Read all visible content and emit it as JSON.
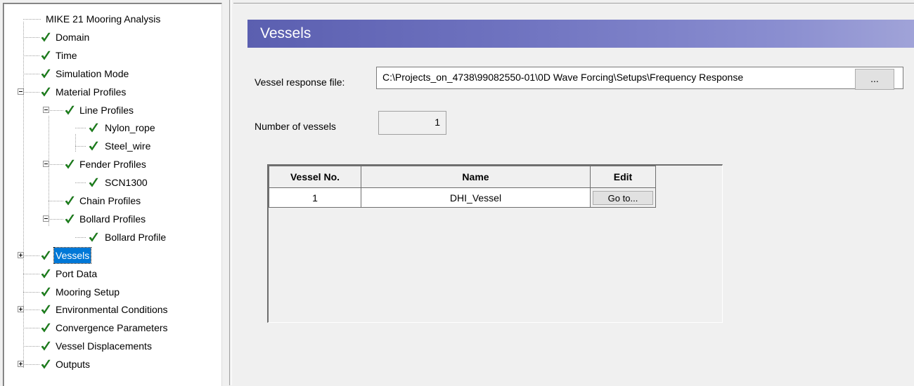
{
  "tree": {
    "items": [
      {
        "label": "MIKE 21 Mooring Analysis",
        "checked": false,
        "expander": "none",
        "level": 0
      },
      {
        "label": "Domain",
        "checked": true,
        "expander": "none",
        "level": 1
      },
      {
        "label": "Time",
        "checked": true,
        "expander": "none",
        "level": 1
      },
      {
        "label": "Simulation Mode",
        "checked": true,
        "expander": "none",
        "level": 1
      },
      {
        "label": "Material Profiles",
        "checked": true,
        "expander": "minus",
        "level": 1
      },
      {
        "label": "Line Profiles",
        "checked": true,
        "expander": "minus",
        "level": 2
      },
      {
        "label": "Nylon_rope",
        "checked": true,
        "expander": "none",
        "level": 3
      },
      {
        "label": "Steel_wire",
        "checked": true,
        "expander": "none",
        "level": 3
      },
      {
        "label": "Fender Profiles",
        "checked": true,
        "expander": "minus",
        "level": 2
      },
      {
        "label": "SCN1300",
        "checked": true,
        "expander": "none",
        "level": 3
      },
      {
        "label": "Chain Profiles",
        "checked": true,
        "expander": "none",
        "level": 2
      },
      {
        "label": "Bollard Profiles",
        "checked": true,
        "expander": "minus",
        "level": 2
      },
      {
        "label": "Bollard Profile",
        "checked": true,
        "expander": "none",
        "level": 3
      },
      {
        "label": "Vessels",
        "checked": true,
        "expander": "plus",
        "level": 1,
        "selected": true
      },
      {
        "label": "Port Data",
        "checked": true,
        "expander": "none",
        "level": 1
      },
      {
        "label": "Mooring Setup",
        "checked": true,
        "expander": "none",
        "level": 1
      },
      {
        "label": "Environmental Conditions",
        "checked": true,
        "expander": "plus",
        "level": 1
      },
      {
        "label": "Convergence Parameters",
        "checked": true,
        "expander": "none",
        "level": 1
      },
      {
        "label": "Vessel Displacements",
        "checked": true,
        "expander": "none",
        "level": 1
      },
      {
        "label": "Outputs",
        "checked": true,
        "expander": "plus",
        "level": 1
      }
    ]
  },
  "panel": {
    "title": "Vessels",
    "response_file_label": "Vessel response file:",
    "response_file_value": "C:\\Projects_on_4738\\99082550-01\\0D Wave Forcing\\Setups\\Frequency Response",
    "browse_label": "...",
    "num_vessels_label": "Number of vessels",
    "num_vessels_value": "1"
  },
  "grid": {
    "headers": [
      "Vessel No.",
      "Name",
      "Edit"
    ],
    "rows": [
      {
        "no": "1",
        "name": "DHI_Vessel",
        "edit": "Go to..."
      }
    ]
  },
  "colors": {
    "header_start": "#5b5fb0",
    "header_end": "#a0a3d8",
    "check_green": "#1e8c1e",
    "selection": "#0078d7"
  }
}
